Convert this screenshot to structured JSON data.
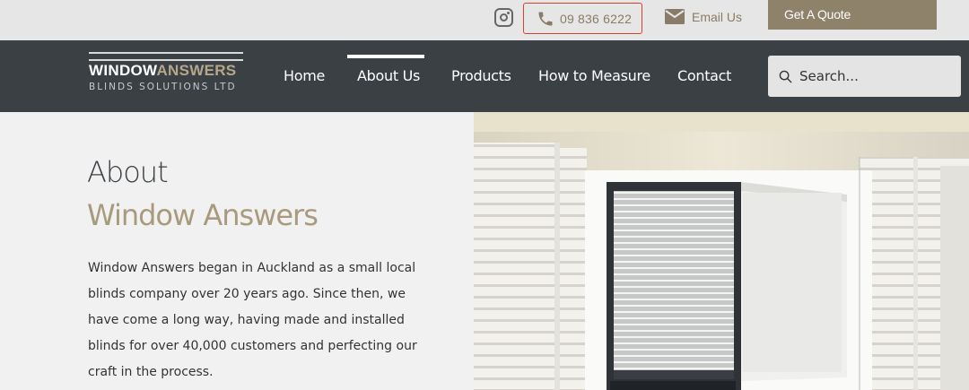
{
  "topbar": {
    "phone": "09 836 6222",
    "email_label": "Email Us",
    "quote_label": "Get A Quote"
  },
  "logo": {
    "brand_part1": "WINDOW",
    "brand_part2": "ANSWERS",
    "tagline": "BLINDS SOLUTIONS LTD"
  },
  "nav": {
    "items": [
      {
        "label": "Home"
      },
      {
        "label": "About Us"
      },
      {
        "label": "Products"
      },
      {
        "label": "How to Measure"
      },
      {
        "label": "Contact"
      }
    ],
    "active": "About Us"
  },
  "search": {
    "placeholder": "Search..."
  },
  "about": {
    "heading_line1": "About",
    "heading_line2": "Window Answers",
    "paragraph_lines": [
      "Window Answers began in Auckland as a small local",
      "blinds company over 20 years ago. Since then, we",
      "have come a long way, having made and installed",
      "blinds for over 40,000 customers and perfecting our",
      "craft in the process."
    ]
  },
  "colors": {
    "nav_bg": "#3b4045",
    "accent": "#a89a7d",
    "quote_bg": "#8e826b",
    "phone_highlight": "#d6412e"
  }
}
